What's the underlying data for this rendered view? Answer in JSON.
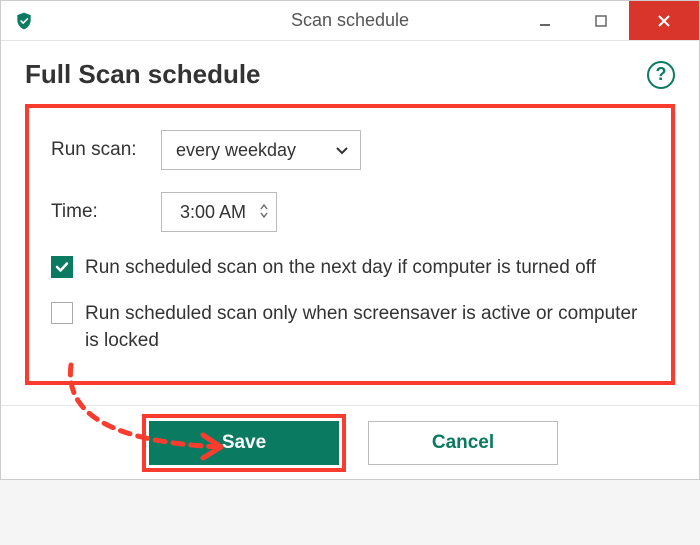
{
  "window": {
    "title": "Scan schedule"
  },
  "header": {
    "title": "Full Scan schedule",
    "help_symbol": "?"
  },
  "settings": {
    "run_scan_label": "Run scan:",
    "run_scan_value": "every weekday",
    "time_label": "Time:",
    "time_value": "3:00 AM",
    "opt1_checked": true,
    "opt1_label": "Run scheduled scan on the next day if computer is turned off",
    "opt2_checked": false,
    "opt2_label": "Run scheduled scan only when screensaver is active or computer is locked"
  },
  "footer": {
    "save_label": "Save",
    "cancel_label": "Cancel"
  },
  "colors": {
    "primary": "#0a7b60",
    "highlight": "#fa3c2f",
    "close": "#d9352a"
  }
}
